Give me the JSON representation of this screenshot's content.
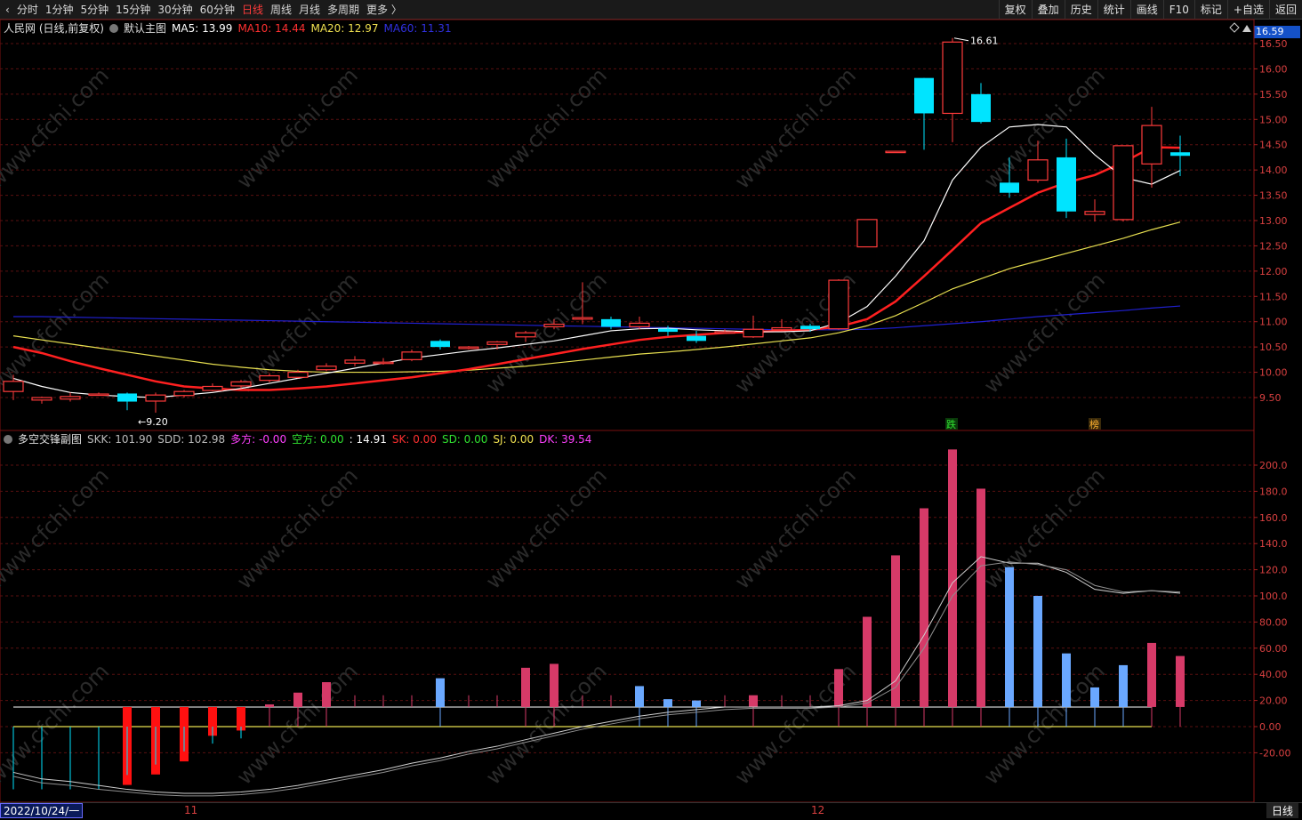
{
  "toolbar": {
    "back_glyph": "‹",
    "timeframes": [
      "分时",
      "1分钟",
      "5分钟",
      "15分钟",
      "30分钟",
      "60分钟",
      "日线",
      "周线",
      "月线",
      "多周期",
      "更多 〉"
    ],
    "active_timeframe": "日线",
    "right_buttons": [
      "复权",
      "叠加",
      "历史",
      "统计",
      "画线",
      "F10",
      "标记",
      "+自选",
      "返回"
    ]
  },
  "main_legend": {
    "title": "人民网 (日线,前复权)",
    "chart_name": "默认主图",
    "ma5": "MA5: 13.99",
    "ma10": "MA10: 14.44",
    "ma20": "MA20: 12.97",
    "ma60": "MA60: 11.31"
  },
  "sub_legend": {
    "title": "多空交锋副图",
    "skk": "SKK: 101.90",
    "sdd": "SDD: 102.98",
    "duofang": "多方: -0.00",
    "kongfang": "空方: 0.00",
    "val": ": 14.91",
    "sk": "SK: 0.00",
    "sd": "SD: 0.00",
    "sj": "SJ: 0.00",
    "dk": "DK: 39.54"
  },
  "price_badge": "16.59",
  "annotations": {
    "high": "16.61",
    "low": "9.20",
    "mark1": "跌",
    "mark2": "榜"
  },
  "colors": {
    "up": "#ff3b3b",
    "down": "#00e4ff",
    "ma5": "#ffffff",
    "ma10": "#ff2020",
    "ma20": "#e8e050",
    "ma60": "#2020d0",
    "grid": "#5a1010",
    "bar_pos": "#d63a68",
    "bar_neg_blue": "#6aa8ff",
    "bar_red": "#ff1010"
  },
  "price_axis": [
    "16.50",
    "16.00",
    "15.50",
    "15.00",
    "14.50",
    "14.00",
    "13.50",
    "13.00",
    "12.50",
    "12.00",
    "11.50",
    "11.00",
    "10.50",
    "10.00",
    "9.50"
  ],
  "sub_axis": [
    "200.0",
    "180.0",
    "160.0",
    "140.0",
    "120.0",
    "100.0",
    "80.00",
    "60.00",
    "40.00",
    "20.00",
    "0.00",
    "-20.00"
  ],
  "date_axis": {
    "start": "2022/10/24/一",
    "m11": "11",
    "m12": "12",
    "period": "日线"
  },
  "candles": [
    [
      9.62,
      9.82,
      9.45,
      9.95
    ],
    [
      9.45,
      9.5,
      9.38,
      9.52
    ],
    [
      9.47,
      9.52,
      9.42,
      9.6
    ],
    [
      9.56,
      9.57,
      9.54,
      9.6
    ],
    [
      9.58,
      9.42,
      9.25,
      9.6
    ],
    [
      9.43,
      9.55,
      9.2,
      9.6
    ],
    [
      9.54,
      9.62,
      9.5,
      9.65
    ],
    [
      9.64,
      9.72,
      9.62,
      9.78
    ],
    [
      9.73,
      9.81,
      9.68,
      9.85
    ],
    [
      9.84,
      9.93,
      9.8,
      9.98
    ],
    [
      9.9,
      10.0,
      9.88,
      10.05
    ],
    [
      10.05,
      10.12,
      10.02,
      10.18
    ],
    [
      10.18,
      10.24,
      10.12,
      10.32
    ],
    [
      10.2,
      10.2,
      10.15,
      10.28
    ],
    [
      10.25,
      10.4,
      10.22,
      10.45
    ],
    [
      10.62,
      10.5,
      10.45,
      10.65
    ],
    [
      10.47,
      10.5,
      10.45,
      10.52
    ],
    [
      10.55,
      10.6,
      10.45,
      10.62
    ],
    [
      10.7,
      10.78,
      10.6,
      10.82
    ],
    [
      10.9,
      10.95,
      10.85,
      11.05
    ],
    [
      11.05,
      11.08,
      10.95,
      11.78
    ],
    [
      11.05,
      10.9,
      10.85,
      11.1
    ],
    [
      10.9,
      10.97,
      10.85,
      11.1
    ],
    [
      10.86,
      10.8,
      10.72,
      10.92
    ],
    [
      10.72,
      10.62,
      10.58,
      10.82
    ],
    [
      10.8,
      10.8,
      10.78,
      10.85
    ],
    [
      10.7,
      10.85,
      10.68,
      11.12
    ],
    [
      10.84,
      10.88,
      10.82,
      11.05
    ],
    [
      10.92,
      10.85,
      10.8,
      10.96
    ],
    [
      10.86,
      11.82,
      10.84,
      11.84
    ],
    [
      12.48,
      13.02,
      12.48,
      13.02
    ],
    [
      14.37,
      14.37,
      14.35,
      14.37
    ],
    [
      15.82,
      15.12,
      14.4,
      15.82
    ],
    [
      15.12,
      16.53,
      14.55,
      16.61
    ],
    [
      15.5,
      14.95,
      14.92,
      15.72
    ],
    [
      13.75,
      13.55,
      13.45,
      14.25
    ],
    [
      13.8,
      14.2,
      13.75,
      14.58
    ],
    [
      14.25,
      13.18,
      13.05,
      14.62
    ],
    [
      13.12,
      13.18,
      12.98,
      13.42
    ],
    [
      13.02,
      14.48,
      12.98,
      14.48
    ],
    [
      14.12,
      14.88,
      13.65,
      15.25
    ],
    [
      14.35,
      14.28,
      13.88,
      14.68
    ]
  ],
  "ma5": [
    9.88,
    9.72,
    9.6,
    9.55,
    9.52,
    9.5,
    9.55,
    9.6,
    9.68,
    9.78,
    9.88,
    9.98,
    10.08,
    10.18,
    10.28,
    10.35,
    10.42,
    10.48,
    10.55,
    10.62,
    10.72,
    10.82,
    10.86,
    10.87,
    10.84,
    10.82,
    10.8,
    10.8,
    10.82,
    10.98,
    11.3,
    11.9,
    12.6,
    13.8,
    14.45,
    14.85,
    14.9,
    14.85,
    14.3,
    13.85,
    13.72,
    13.99
  ],
  "ma10": [
    10.5,
    10.38,
    10.22,
    10.08,
    9.95,
    9.82,
    9.72,
    9.68,
    9.65,
    9.65,
    9.68,
    9.72,
    9.78,
    9.84,
    9.9,
    9.98,
    10.06,
    10.16,
    10.26,
    10.36,
    10.46,
    10.55,
    10.64,
    10.7,
    10.74,
    10.78,
    10.8,
    10.82,
    10.84,
    10.9,
    11.05,
    11.4,
    11.9,
    12.42,
    12.95,
    13.25,
    13.55,
    13.75,
    13.9,
    14.15,
    14.45,
    14.44
  ],
  "ma20": [
    10.72,
    10.64,
    10.56,
    10.48,
    10.4,
    10.32,
    10.24,
    10.16,
    10.1,
    10.05,
    10.02,
    10.0,
    10.0,
    10.0,
    10.01,
    10.02,
    10.04,
    10.08,
    10.12,
    10.18,
    10.24,
    10.3,
    10.36,
    10.4,
    10.45,
    10.5,
    10.56,
    10.62,
    10.68,
    10.78,
    10.92,
    11.12,
    11.38,
    11.65,
    11.85,
    12.05,
    12.2,
    12.35,
    12.5,
    12.65,
    12.82,
    12.97
  ],
  "ma60": [
    11.1,
    11.1,
    11.09,
    11.08,
    11.07,
    11.06,
    11.05,
    11.04,
    11.03,
    11.02,
    11.01,
    11.0,
    10.99,
    10.98,
    10.97,
    10.96,
    10.95,
    10.94,
    10.93,
    10.92,
    10.91,
    10.9,
    10.89,
    10.88,
    10.87,
    10.86,
    10.85,
    10.84,
    10.84,
    10.84,
    10.85,
    10.88,
    10.92,
    10.96,
    11.0,
    11.05,
    11.1,
    11.14,
    11.18,
    11.22,
    11.27,
    11.31
  ],
  "sub_bars": [
    [
      0,
      "none"
    ],
    [
      0,
      "none"
    ],
    [
      0,
      "none"
    ],
    [
      0,
      "none"
    ],
    [
      -31,
      "red"
    ],
    [
      -23,
      "red"
    ],
    [
      -13,
      "red"
    ],
    [
      -7,
      "red"
    ],
    [
      -3,
      "red"
    ],
    [
      17,
      "pink"
    ],
    [
      26,
      "pink"
    ],
    [
      34,
      "pink"
    ],
    [
      15,
      "thin"
    ],
    [
      15,
      "thin"
    ],
    [
      15,
      "thin"
    ],
    [
      37,
      "blue"
    ],
    [
      15,
      "thin"
    ],
    [
      15,
      "thin"
    ],
    [
      45,
      "pink"
    ],
    [
      48,
      "pink"
    ],
    [
      15,
      "thin"
    ],
    [
      15,
      "thin"
    ],
    [
      31,
      "blue"
    ],
    [
      21,
      "blue"
    ],
    [
      20,
      "blue"
    ],
    [
      15,
      "thin"
    ],
    [
      24,
      "pink"
    ],
    [
      15,
      "thin"
    ],
    [
      15,
      "thin"
    ],
    [
      44,
      "pink"
    ],
    [
      84,
      "pink"
    ],
    [
      131,
      "pink"
    ],
    [
      167,
      "pink"
    ],
    [
      212,
      "pink"
    ],
    [
      182,
      "pink"
    ],
    [
      122,
      "blue"
    ],
    [
      100,
      "blue"
    ],
    [
      56,
      "blue"
    ],
    [
      30,
      "blue"
    ],
    [
      47,
      "blue"
    ],
    [
      64,
      "pink"
    ],
    [
      54,
      "pink"
    ]
  ],
  "skk": [
    -35,
    -40,
    -42,
    -45,
    -48,
    -50,
    -51,
    -51,
    -50,
    -48,
    -45,
    -41,
    -37,
    -33,
    -28,
    -24,
    -19,
    -15,
    -10,
    -5,
    0,
    4,
    8,
    11,
    13,
    15,
    15,
    15,
    15,
    16,
    20,
    35,
    70,
    110,
    130,
    125,
    125,
    118,
    105,
    102,
    104,
    102
  ],
  "sdd": [
    -38,
    -43,
    -45,
    -48,
    -50,
    -52,
    -53,
    -53,
    -52,
    -50,
    -47,
    -43,
    -39,
    -35,
    -30,
    -26,
    -21,
    -17,
    -12,
    -7,
    -2,
    2,
    6,
    9,
    11,
    13,
    14,
    14,
    14,
    15,
    18,
    30,
    60,
    100,
    123,
    126,
    124,
    120,
    108,
    103,
    104,
    103
  ]
}
